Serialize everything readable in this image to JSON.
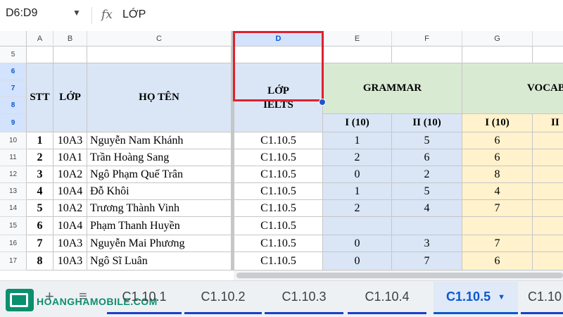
{
  "formula_bar": {
    "name_box": "D6:D9",
    "caret": "▼",
    "fx_label": "fx",
    "content": "LỚP"
  },
  "columns": [
    "A",
    "B",
    "C",
    "D",
    "E",
    "F",
    "G"
  ],
  "rows": [
    "5",
    "6",
    "7",
    "8",
    "9",
    "10",
    "11",
    "12",
    "13",
    "14",
    "15",
    "16",
    "17"
  ],
  "headers": {
    "stt": "STT",
    "lop": "LỚP",
    "ho_ten": "HỌ TÊN",
    "lop_ielts_1": "LỚP",
    "lop_ielts_2": "IELTS",
    "grammar": "GRAMMAR",
    "vocab": "VOCAB",
    "g_i": "I (10)",
    "g_ii": "II (10)",
    "v_i": "I (10)",
    "v_ii": "II"
  },
  "students": [
    {
      "stt": "1",
      "lop": "10A3",
      "name": "Nguyễn Nam Khánh",
      "ielts": "C1.10.5",
      "g1": "1",
      "g2": "5",
      "v1": "6"
    },
    {
      "stt": "2",
      "lop": "10A1",
      "name": "Trần Hoàng Sang",
      "ielts": "C1.10.5",
      "g1": "2",
      "g2": "6",
      "v1": "6"
    },
    {
      "stt": "3",
      "lop": "10A2",
      "name": "Ngô Phạm Quế Trân",
      "ielts": "C1.10.5",
      "g1": "0",
      "g2": "2",
      "v1": "8"
    },
    {
      "stt": "4",
      "lop": "10A4",
      "name": "Đỗ Khôi",
      "ielts": "C1.10.5",
      "g1": "1",
      "g2": "5",
      "v1": "4"
    },
    {
      "stt": "5",
      "lop": "10A2",
      "name": "Trương Thành Vinh",
      "ielts": "C1.10.5",
      "g1": "2",
      "g2": "4",
      "v1": "7"
    },
    {
      "stt": "6",
      "lop": "10A4",
      "name": "Phạm Thanh Huyền",
      "ielts": "C1.10.5",
      "g1": "",
      "g2": "",
      "v1": ""
    },
    {
      "stt": "7",
      "lop": "10A3",
      "name": "Nguyễn Mai Phương",
      "ielts": "C1.10.5",
      "g1": "0",
      "g2": "3",
      "v1": "7"
    },
    {
      "stt": "8",
      "lop": "10A3",
      "name": "Ngô Sĩ Luân",
      "ielts": "C1.10.5",
      "g1": "0",
      "g2": "7",
      "v1": "6"
    }
  ],
  "tabbar": {
    "logo_text": "HOANGHAMOBILE.COM",
    "add_icon": "+",
    "menu_icon": "≡",
    "tabs": [
      "C1.10.1",
      "C1.10.2",
      "C1.10.3",
      "C1.10.4",
      "C1.10.5",
      "C1.10"
    ],
    "active_caret": "▼"
  },
  "colors": {
    "accent": "#0b57d0",
    "selection_border": "#e0202f",
    "header_blue": "#dae6f6",
    "grammar_green": "#d9ead3",
    "vocab_yellow": "#fff2cc"
  }
}
